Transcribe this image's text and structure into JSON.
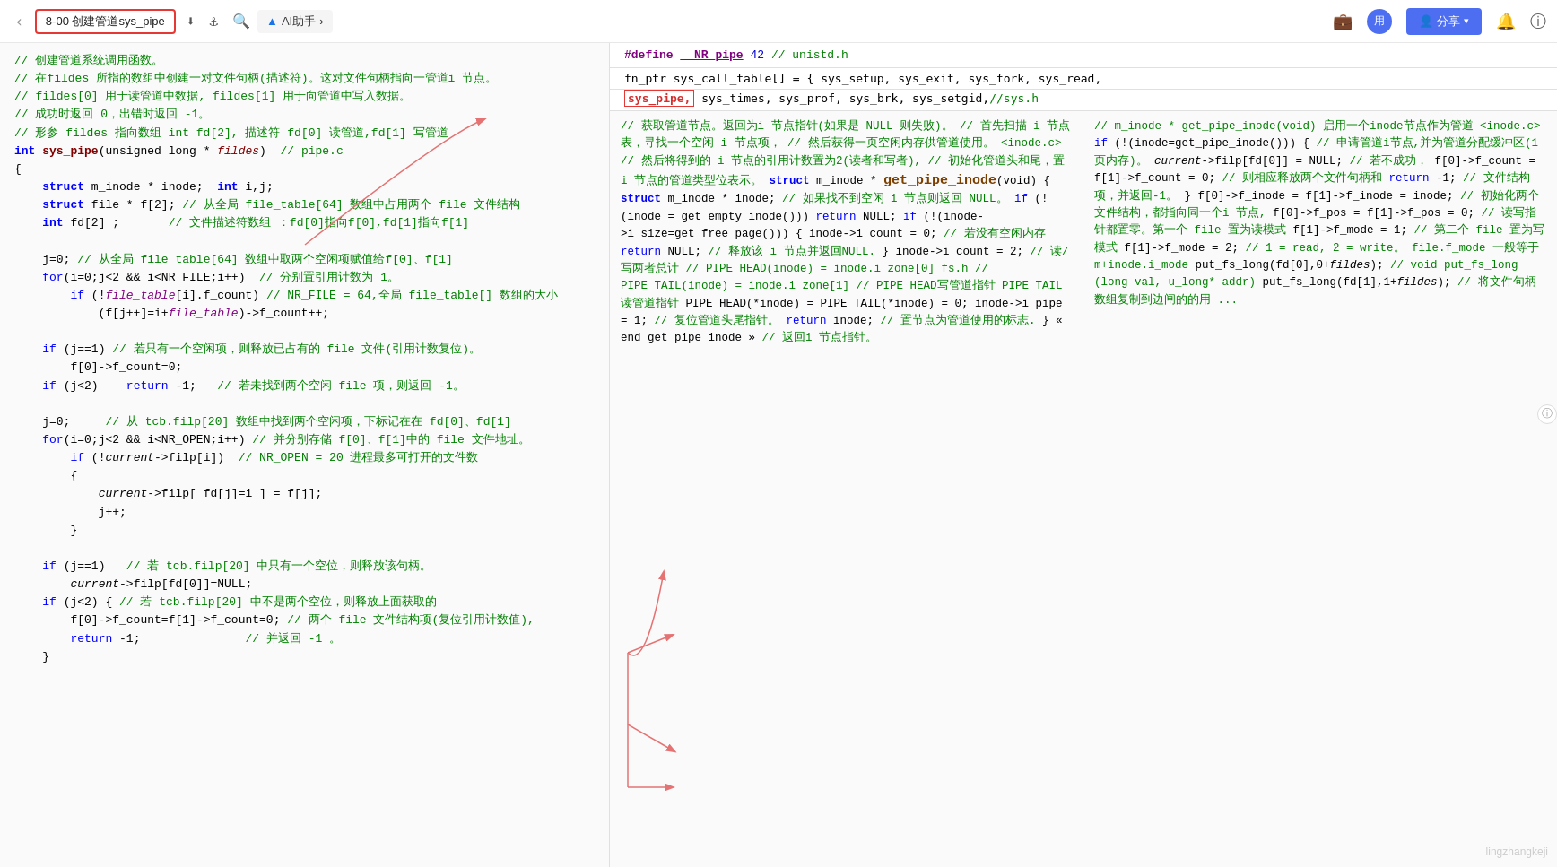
{
  "header": {
    "back_label": "‹",
    "tab_label": "8-00 创建管道sys_pipe",
    "icon_download": "⬇",
    "icon_tag": "🏷",
    "icon_search": "🔍",
    "ai_logo": "▲",
    "ai_label": "AI助手",
    "ai_arrow": "›",
    "share_label": "分享",
    "share_dropdown": "▾",
    "avatar_label": "用",
    "bell_label": "🔔",
    "circle_i": "ⓘ"
  },
  "top_strip": {
    "line1_define": "#define __NR_pipe 42 // unistd.h",
    "line2": "fn_ptr sys_call_table[] = { sys_setup, sys_exit, sys_fork, sys_read,",
    "line3_left": "sys_pipe,",
    "line3_rest": " sys_times, sys_prof, sys_brk, sys_setgid,//sys.h"
  },
  "left_code": {
    "title": "// 创建管道系统调用函数。"
  },
  "watermark": "lingzhangkeji"
}
